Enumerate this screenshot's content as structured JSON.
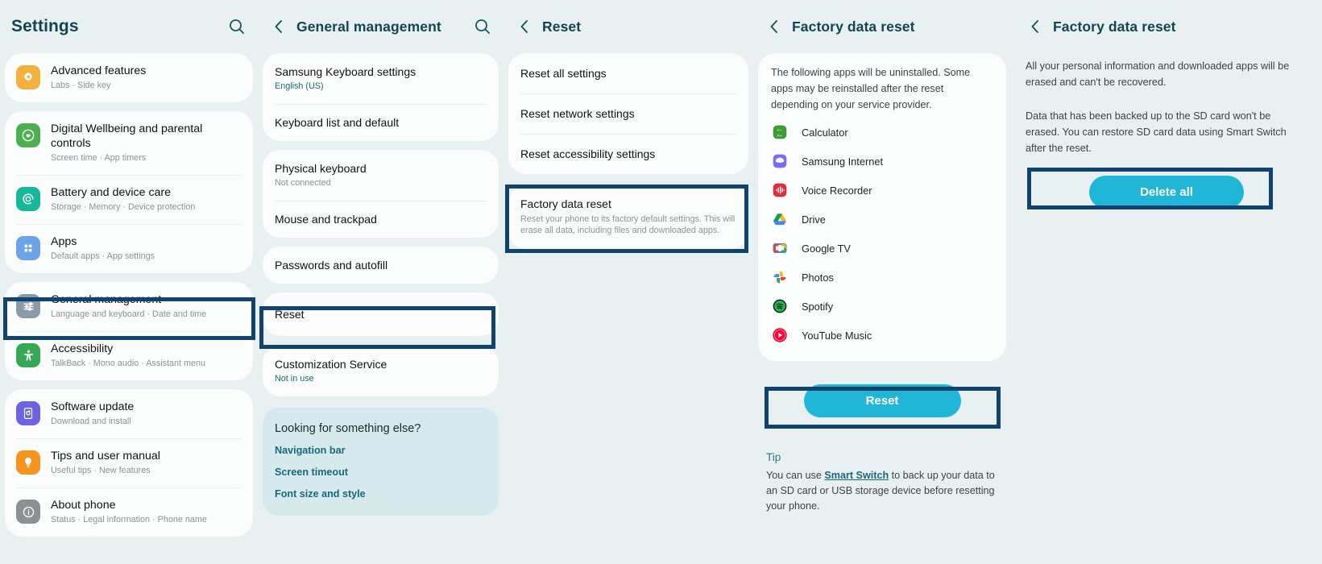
{
  "panels": {
    "settings": {
      "title": "Settings",
      "search_icon": "search-icon",
      "groups": [
        {
          "items": [
            {
              "title": "Advanced features",
              "subtitle": "Labs  ·  Side key",
              "icon": "advanced-features-icon",
              "color": "#f4b13e"
            }
          ]
        },
        {
          "items": [
            {
              "title": "Digital Wellbeing and parental controls",
              "subtitle": "Screen time  ·  App timers",
              "icon": "digital-wellbeing-icon",
              "color": "#4cb050"
            },
            {
              "title": "Battery and device care",
              "subtitle": "Storage  ·  Memory  ·  Device protection",
              "icon": "battery-device-care-icon",
              "color": "#17b89a"
            },
            {
              "title": "Apps",
              "subtitle": "Default apps  ·  App settings",
              "icon": "apps-icon",
              "color": "#6ba4e8"
            }
          ]
        },
        {
          "items": [
            {
              "title": "General management",
              "subtitle": "Language and keyboard  ·  Date and time",
              "icon": "general-management-icon",
              "color": "#8a9aa8"
            },
            {
              "title": "Accessibility",
              "subtitle": "TalkBack  ·  Mono audio  ·  Assistant menu",
              "icon": "accessibility-icon",
              "color": "#35a853"
            }
          ]
        },
        {
          "items": [
            {
              "title": "Software update",
              "subtitle": "Download and install",
              "icon": "software-update-icon",
              "color": "#6c63e0"
            },
            {
              "title": "Tips and user manual",
              "subtitle": "Useful tips  ·  New features",
              "icon": "tips-icon",
              "color": "#f7941e"
            },
            {
              "title": "About phone",
              "subtitle": "Status  ·  Legal information  ·  Phone name",
              "icon": "about-phone-icon",
              "color": "#8b9194"
            }
          ]
        }
      ]
    },
    "general_management": {
      "title": "General management",
      "back_icon": "back-chevron-icon",
      "search_icon": "search-icon",
      "groups": [
        {
          "items": [
            {
              "title": "Samsung Keyboard settings",
              "subtitle": "English (US)",
              "subtitle_style": "teal"
            },
            {
              "title": "Keyboard list and default",
              "subtitle": ""
            }
          ]
        },
        {
          "items": [
            {
              "title": "Physical keyboard",
              "subtitle": "Not connected"
            },
            {
              "title": "Mouse and trackpad",
              "subtitle": ""
            }
          ]
        },
        {
          "items": [
            {
              "title": "Passwords and autofill",
              "subtitle": ""
            }
          ]
        },
        {
          "items": [
            {
              "title": "Reset",
              "subtitle": ""
            }
          ]
        },
        {
          "items": [
            {
              "title": "Customization Service",
              "subtitle": "Not in use",
              "subtitle_style": "teal"
            }
          ]
        }
      ],
      "looking_for": {
        "title": "Looking for something else?",
        "links": [
          "Navigation bar",
          "Screen timeout",
          "Font size and style"
        ]
      }
    },
    "reset": {
      "title": "Reset",
      "back_icon": "back-chevron-icon",
      "groups": [
        {
          "items": [
            {
              "title": "Reset all settings",
              "subtitle": ""
            },
            {
              "title": "Reset network settings",
              "subtitle": ""
            },
            {
              "title": "Reset accessibility settings",
              "subtitle": ""
            }
          ]
        },
        {
          "items": [
            {
              "title": "Factory data reset",
              "subtitle": "Reset your phone to its factory default settings. This will erase all data, including files and downloaded apps."
            }
          ]
        }
      ]
    },
    "factory_reset_apps": {
      "title": "Factory data reset",
      "back_icon": "back-chevron-icon",
      "blurb": "The following apps will be uninstalled. Some apps may be reinstalled after the reset depending on your service provider.",
      "apps": [
        {
          "name": "Calculator",
          "icon": "calculator-app-icon"
        },
        {
          "name": "Samsung Internet",
          "icon": "samsung-internet-app-icon"
        },
        {
          "name": "Voice Recorder",
          "icon": "voice-recorder-app-icon"
        },
        {
          "name": "Drive",
          "icon": "google-drive-app-icon"
        },
        {
          "name": "Google TV",
          "icon": "google-tv-app-icon"
        },
        {
          "name": "Photos",
          "icon": "google-photos-app-icon"
        },
        {
          "name": "Spotify",
          "icon": "spotify-app-icon"
        },
        {
          "name": "YouTube Music",
          "icon": "youtube-music-app-icon"
        }
      ],
      "reset_button": "Reset",
      "tip_heading": "Tip",
      "tip_before": "You can use ",
      "tip_link": "Smart Switch",
      "tip_after": " to back up your data to an SD card or USB storage device before resetting your phone."
    },
    "factory_reset_confirm": {
      "title": "Factory data reset",
      "back_icon": "back-chevron-icon",
      "paragraph1": "All your personal information and downloaded apps will be erased and can't be recovered.",
      "paragraph2": "Data that has been backed up to the SD card won't be erased. You can restore SD card data using Smart Switch after the reset.",
      "delete_button": "Delete all"
    }
  },
  "colors": {
    "background": "#e9f0f2",
    "card": "#fbfcfc",
    "header_text": "#11464e",
    "highlight_border": "#10436e",
    "accent_button": "#1fb6d8",
    "link_teal": "#19697a",
    "looking_for_bg": "#d6e9ed"
  }
}
